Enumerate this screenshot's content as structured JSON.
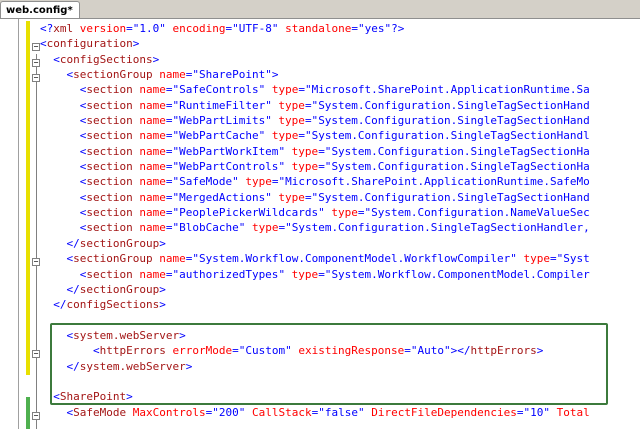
{
  "tab": {
    "label": "web.config*"
  },
  "lines": [
    [
      [
        "p",
        "<?"
      ],
      [
        "t",
        "xml"
      ],
      [
        "a",
        " version"
      ],
      [
        "p",
        "=\""
      ],
      [
        "v",
        "1.0"
      ],
      [
        "p",
        "\""
      ],
      [
        "a",
        " encoding"
      ],
      [
        "p",
        "=\""
      ],
      [
        "v",
        "UTF-8"
      ],
      [
        "p",
        "\""
      ],
      [
        "a",
        " standalone"
      ],
      [
        "p",
        "=\""
      ],
      [
        "v",
        "yes"
      ],
      [
        "p",
        "\"?>"
      ]
    ],
    [
      [
        "p",
        "<"
      ],
      [
        "t",
        "configuration"
      ],
      [
        "p",
        ">"
      ]
    ],
    [
      [
        "p",
        "  <"
      ],
      [
        "t",
        "configSections"
      ],
      [
        "p",
        ">"
      ]
    ],
    [
      [
        "p",
        "    <"
      ],
      [
        "t",
        "sectionGroup"
      ],
      [
        "a",
        " name"
      ],
      [
        "p",
        "=\""
      ],
      [
        "v",
        "SharePoint"
      ],
      [
        "p",
        "\">"
      ]
    ],
    [
      [
        "p",
        "      <"
      ],
      [
        "t",
        "section"
      ],
      [
        "a",
        " name"
      ],
      [
        "p",
        "=\""
      ],
      [
        "v",
        "SafeControls"
      ],
      [
        "p",
        "\""
      ],
      [
        "a",
        " type"
      ],
      [
        "p",
        "=\""
      ],
      [
        "v",
        "Microsoft.SharePoint.ApplicationRuntime.Sa"
      ]
    ],
    [
      [
        "p",
        "      <"
      ],
      [
        "t",
        "section"
      ],
      [
        "a",
        " name"
      ],
      [
        "p",
        "=\""
      ],
      [
        "v",
        "RuntimeFilter"
      ],
      [
        "p",
        "\""
      ],
      [
        "a",
        " type"
      ],
      [
        "p",
        "=\""
      ],
      [
        "v",
        "System.Configuration.SingleTagSectionHand"
      ]
    ],
    [
      [
        "p",
        "      <"
      ],
      [
        "t",
        "section"
      ],
      [
        "a",
        " name"
      ],
      [
        "p",
        "=\""
      ],
      [
        "v",
        "WebPartLimits"
      ],
      [
        "p",
        "\""
      ],
      [
        "a",
        " type"
      ],
      [
        "p",
        "=\""
      ],
      [
        "v",
        "System.Configuration.SingleTagSectionHand"
      ]
    ],
    [
      [
        "p",
        "      <"
      ],
      [
        "t",
        "section"
      ],
      [
        "a",
        " name"
      ],
      [
        "p",
        "=\""
      ],
      [
        "v",
        "WebPartCache"
      ],
      [
        "p",
        "\""
      ],
      [
        "a",
        " type"
      ],
      [
        "p",
        "=\""
      ],
      [
        "v",
        "System.Configuration.SingleTagSectionHandl"
      ]
    ],
    [
      [
        "p",
        "      <"
      ],
      [
        "t",
        "section"
      ],
      [
        "a",
        " name"
      ],
      [
        "p",
        "=\""
      ],
      [
        "v",
        "WebPartWorkItem"
      ],
      [
        "p",
        "\""
      ],
      [
        "a",
        " type"
      ],
      [
        "p",
        "=\""
      ],
      [
        "v",
        "System.Configuration.SingleTagSectionHa"
      ]
    ],
    [
      [
        "p",
        "      <"
      ],
      [
        "t",
        "section"
      ],
      [
        "a",
        " name"
      ],
      [
        "p",
        "=\""
      ],
      [
        "v",
        "WebPartControls"
      ],
      [
        "p",
        "\""
      ],
      [
        "a",
        " type"
      ],
      [
        "p",
        "=\""
      ],
      [
        "v",
        "System.Configuration.SingleTagSectionHa"
      ]
    ],
    [
      [
        "p",
        "      <"
      ],
      [
        "t",
        "section"
      ],
      [
        "a",
        " name"
      ],
      [
        "p",
        "=\""
      ],
      [
        "v",
        "SafeMode"
      ],
      [
        "p",
        "\""
      ],
      [
        "a",
        " type"
      ],
      [
        "p",
        "=\""
      ],
      [
        "v",
        "Microsoft.SharePoint.ApplicationRuntime.SafeMo"
      ]
    ],
    [
      [
        "p",
        "      <"
      ],
      [
        "t",
        "section"
      ],
      [
        "a",
        " name"
      ],
      [
        "p",
        "=\""
      ],
      [
        "v",
        "MergedActions"
      ],
      [
        "p",
        "\""
      ],
      [
        "a",
        " type"
      ],
      [
        "p",
        "=\""
      ],
      [
        "v",
        "System.Configuration.SingleTagSectionHand"
      ]
    ],
    [
      [
        "p",
        "      <"
      ],
      [
        "t",
        "section"
      ],
      [
        "a",
        " name"
      ],
      [
        "p",
        "=\""
      ],
      [
        "v",
        "PeoplePickerWildcards"
      ],
      [
        "p",
        "\""
      ],
      [
        "a",
        " type"
      ],
      [
        "p",
        "=\""
      ],
      [
        "v",
        "System.Configuration.NameValueSec"
      ]
    ],
    [
      [
        "p",
        "      <"
      ],
      [
        "t",
        "section"
      ],
      [
        "a",
        " name"
      ],
      [
        "p",
        "=\""
      ],
      [
        "v",
        "BlobCache"
      ],
      [
        "p",
        "\""
      ],
      [
        "a",
        " type"
      ],
      [
        "p",
        "=\""
      ],
      [
        "v",
        "System.Configuration.SingleTagSectionHandler,"
      ]
    ],
    [
      [
        "p",
        "    </"
      ],
      [
        "t",
        "sectionGroup"
      ],
      [
        "p",
        ">"
      ]
    ],
    [
      [
        "p",
        "    <"
      ],
      [
        "t",
        "sectionGroup"
      ],
      [
        "a",
        " name"
      ],
      [
        "p",
        "=\""
      ],
      [
        "v",
        "System.Workflow.ComponentModel.WorkflowCompiler"
      ],
      [
        "p",
        "\""
      ],
      [
        "a",
        " type"
      ],
      [
        "p",
        "=\""
      ],
      [
        "v",
        "Syst"
      ]
    ],
    [
      [
        "p",
        "      <"
      ],
      [
        "t",
        "section"
      ],
      [
        "a",
        " name"
      ],
      [
        "p",
        "=\""
      ],
      [
        "v",
        "authorizedTypes"
      ],
      [
        "p",
        "\""
      ],
      [
        "a",
        " type"
      ],
      [
        "p",
        "=\""
      ],
      [
        "v",
        "System.Workflow.ComponentModel.Compiler"
      ]
    ],
    [
      [
        "p",
        "    </"
      ],
      [
        "t",
        "sectionGroup"
      ],
      [
        "p",
        ">"
      ]
    ],
    [
      [
        "p",
        "  </"
      ],
      [
        "t",
        "configSections"
      ],
      [
        "p",
        ">"
      ]
    ],
    [
      [
        "p",
        ""
      ]
    ],
    [
      [
        "p",
        "    <"
      ],
      [
        "t",
        "system.webServer"
      ],
      [
        "p",
        ">"
      ]
    ],
    [
      [
        "p",
        "        <"
      ],
      [
        "t",
        "httpErrors"
      ],
      [
        "a",
        " errorMode"
      ],
      [
        "p",
        "=\""
      ],
      [
        "v",
        "Custom"
      ],
      [
        "p",
        "\""
      ],
      [
        "a",
        " existingResponse"
      ],
      [
        "p",
        "=\""
      ],
      [
        "v",
        "Auto"
      ],
      [
        "p",
        "\"></"
      ],
      [
        "t",
        "httpErrors"
      ],
      [
        "p",
        ">"
      ]
    ],
    [
      [
        "p",
        "    </"
      ],
      [
        "t",
        "system.webServer"
      ],
      [
        "p",
        ">"
      ]
    ],
    [
      [
        "p",
        ""
      ]
    ],
    [
      [
        "p",
        "  <"
      ],
      [
        "t",
        "SharePoint"
      ],
      [
        "p",
        ">"
      ]
    ],
    [
      [
        "p",
        "    <"
      ],
      [
        "t",
        "SafeMode"
      ],
      [
        "a",
        " MaxControls"
      ],
      [
        "p",
        "=\""
      ],
      [
        "v",
        "200"
      ],
      [
        "p",
        "\""
      ],
      [
        "a",
        " CallStack"
      ],
      [
        "p",
        "=\""
      ],
      [
        "v",
        "false"
      ],
      [
        "p",
        "\""
      ],
      [
        "a",
        " DirectFileDependencies"
      ],
      [
        "p",
        "=\""
      ],
      [
        "v",
        "10"
      ],
      [
        "p",
        "\""
      ],
      [
        "a",
        " Total"
      ]
    ]
  ]
}
